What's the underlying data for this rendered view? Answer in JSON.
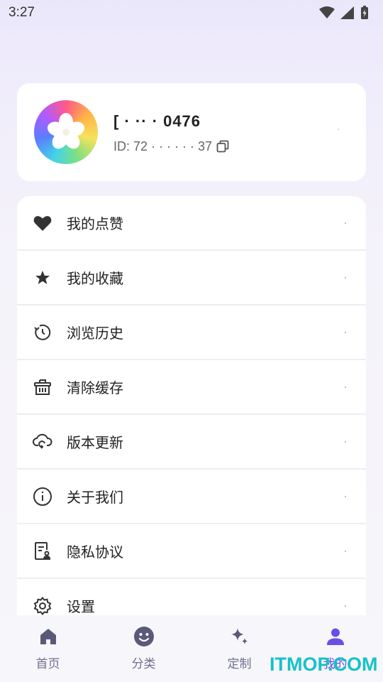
{
  "status_bar": {
    "time": "3:27",
    "icons": [
      "wifi-icon",
      "cellular-signal-icon",
      "battery-charging-icon"
    ]
  },
  "profile": {
    "name": "[  · ·· · 0476",
    "id_text": "ID: 72 · · · · · · 37",
    "avatar": "pinwheel-avatar"
  },
  "menu": {
    "items": [
      {
        "label": "我的点赞",
        "icon": "heart-icon"
      },
      {
        "label": "我的收藏",
        "icon": "star-icon"
      },
      {
        "label": "浏览历史",
        "icon": "history-clock-icon"
      },
      {
        "label": "清除缓存",
        "icon": "trash-basket-icon"
      },
      {
        "label": "版本更新",
        "icon": "cloud-update-icon"
      },
      {
        "label": "关于我们",
        "icon": "info-icon"
      },
      {
        "label": "隐私协议",
        "icon": "privacy-document-icon"
      },
      {
        "label": "设置",
        "icon": "settings-gear-icon"
      }
    ]
  },
  "bottom_nav": {
    "items": [
      {
        "label": "首页",
        "icon": "home-icon"
      },
      {
        "label": "分类",
        "icon": "smiley-icon"
      },
      {
        "label": "定制",
        "icon": "sparkle-icon"
      },
      {
        "label": "我的",
        "icon": "user-icon"
      }
    ],
    "active_index": 3
  },
  "colors": {
    "accent": "#6a4ee6",
    "icon_dark": "#2f2f3a",
    "nav_icon": "#5a5a78"
  },
  "watermark": "ITMOP.COM"
}
